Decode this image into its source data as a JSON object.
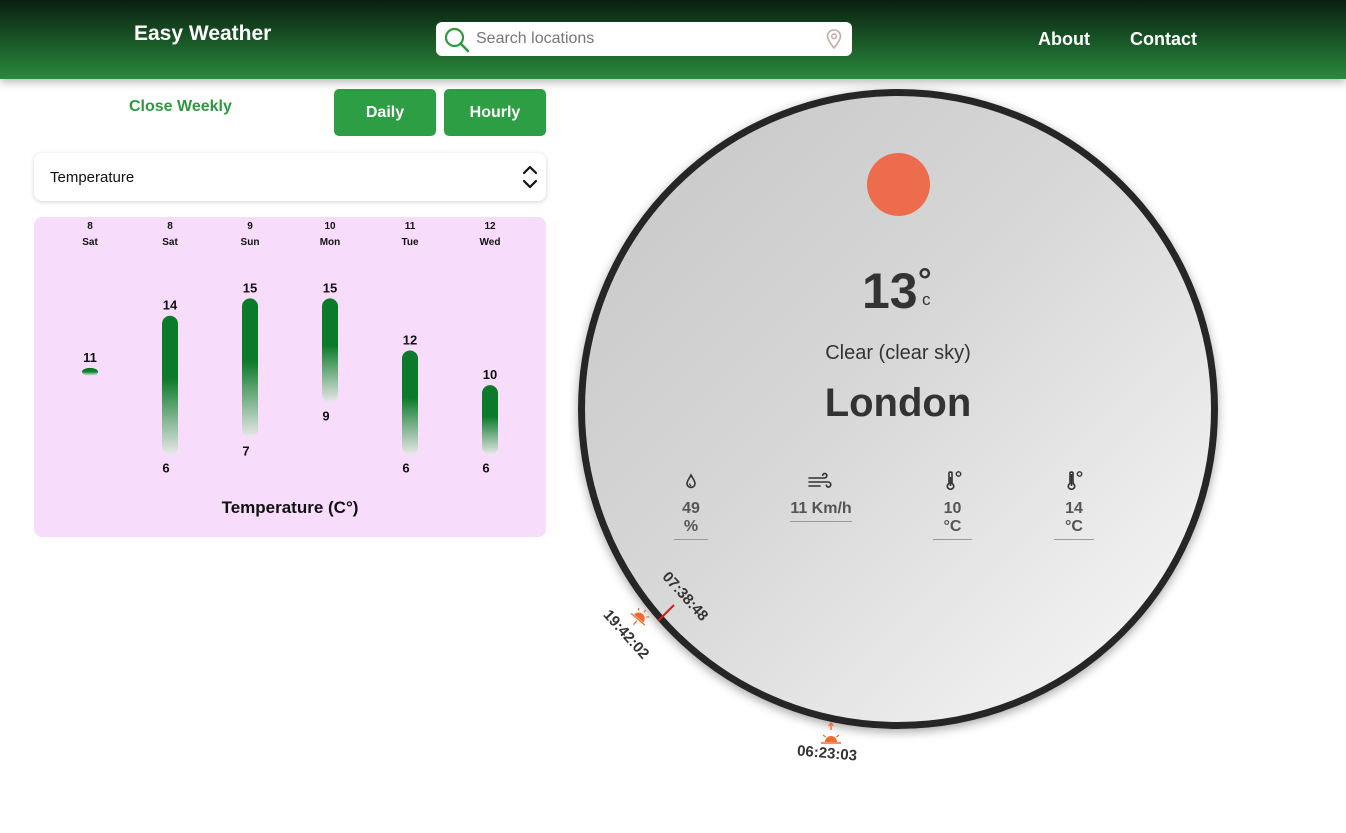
{
  "header": {
    "brand": "Easy Weather",
    "search_placeholder": "Search locations",
    "nav": {
      "about": "About",
      "contact": "Contact"
    }
  },
  "controls": {
    "close_weekly": "Close Weekly",
    "daily": "Daily",
    "hourly": "Hourly",
    "metric_select": "Temperature"
  },
  "chart_data": {
    "type": "bar",
    "title": "Temperature (C°)",
    "categories": [
      {
        "date": "8",
        "day": "Sat"
      },
      {
        "date": "8",
        "day": "Sat"
      },
      {
        "date": "9",
        "day": "Sun"
      },
      {
        "date": "10",
        "day": "Mon"
      },
      {
        "date": "11",
        "day": "Tue"
      },
      {
        "date": "12",
        "day": "Wed"
      }
    ],
    "series": [
      {
        "name": "max",
        "values": [
          11,
          14,
          15,
          15,
          12,
          10
        ]
      },
      {
        "name": "min",
        "values": [
          11,
          6,
          7,
          9,
          6,
          6
        ]
      }
    ],
    "show_min_label": [
      false,
      true,
      true,
      true,
      true,
      true
    ],
    "ylim": [
      5,
      16
    ],
    "colors": {
      "bar_top": "#0b7a2a",
      "panel": "#f7ddfb"
    }
  },
  "current": {
    "temperature": "13",
    "degree": "°",
    "unit": "c",
    "condition": "Clear (clear sky)",
    "city": "London",
    "stats": [
      {
        "icon": "humidity-icon",
        "value": "49 %"
      },
      {
        "icon": "wind-icon",
        "value": "11 Km/h"
      },
      {
        "icon": "thermometer-low-icon",
        "value": "10 °C"
      },
      {
        "icon": "thermometer-high-icon",
        "value": "14 °C"
      }
    ],
    "sun_color": "#ec6c4d"
  },
  "sun_times": {
    "current_time": "07:38:48",
    "sunset": "19:42:02",
    "sunrise": "06:23:03"
  }
}
